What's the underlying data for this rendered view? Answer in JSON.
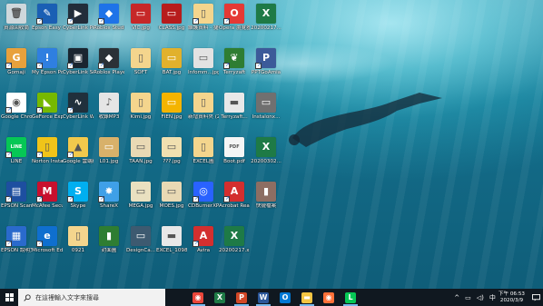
{
  "desktop": {
    "icons": [
      {
        "label": "資源回收筒",
        "color": "#cfd8dc",
        "glyph": "🗑",
        "shortcut": false,
        "col": 0,
        "row": 0
      },
      {
        "label": "Gomaji",
        "color": "#e8a13c",
        "glyph": "G",
        "shortcut": true,
        "col": 0,
        "row": 1
      },
      {
        "label": "Google Chrome",
        "color": "#ffffff",
        "glyph": "◉",
        "shortcut": true,
        "col": 0,
        "row": 2
      },
      {
        "label": "LINE",
        "color": "#06c755",
        "glyph": "LINE",
        "shortcut": true,
        "col": 0,
        "row": 3
      },
      {
        "label": "EPSON Scan",
        "color": "#1d4fa0",
        "glyph": "▤",
        "shortcut": true,
        "col": 0,
        "row": 4
      },
      {
        "label": "EPSON 說明文件",
        "color": "#2a6acc",
        "glyph": "▦",
        "shortcut": true,
        "col": 0,
        "row": 5
      },
      {
        "label": "Epson Easy Photo Print",
        "color": "#1a5fb4",
        "glyph": "✎",
        "shortcut": true,
        "col": 1,
        "row": 0
      },
      {
        "label": "My Epson Portal",
        "color": "#2f7fe0",
        "glyph": "!",
        "shortcut": true,
        "col": 1,
        "row": 1
      },
      {
        "label": "GeForce Experience",
        "color": "#76b900",
        "glyph": "◣",
        "shortcut": true,
        "col": 1,
        "row": 2
      },
      {
        "label": "Norton Installation",
        "color": "#f0c419",
        "glyph": "▯",
        "shortcut": true,
        "col": 1,
        "row": 3
      },
      {
        "label": "McAfee Security...",
        "color": "#c8102e",
        "glyph": "M",
        "shortcut": true,
        "col": 1,
        "row": 4
      },
      {
        "label": "Microsoft Edge",
        "color": "#0f6fcf",
        "glyph": "e",
        "shortcut": true,
        "col": 1,
        "row": 5
      },
      {
        "label": "CyberLink PowerDirec...",
        "color": "#222d3a",
        "glyph": "▶",
        "shortcut": true,
        "col": 2,
        "row": 0
      },
      {
        "label": "CyberLink Screen Re...",
        "color": "#1a2530",
        "glyph": "▣",
        "shortcut": true,
        "col": 2,
        "row": 1
      },
      {
        "label": "CyberLink WaveEdit...",
        "color": "#20303c",
        "glyph": "∿",
        "shortcut": true,
        "col": 2,
        "row": 2
      },
      {
        "label": "Google 雲端硬碟",
        "color": "#f2c94c",
        "glyph": "▲",
        "shortcut": true,
        "col": 2,
        "row": 3
      },
      {
        "label": "Skype",
        "color": "#00aff0",
        "glyph": "S",
        "shortcut": true,
        "col": 2,
        "row": 4
      },
      {
        "label": "0921",
        "color": "#f4d58d",
        "glyph": "▯",
        "shortcut": false,
        "col": 2,
        "row": 5
      },
      {
        "label": "Roblox Studio",
        "color": "#1e73e8",
        "glyph": "◆",
        "shortcut": true,
        "col": 3,
        "row": 0
      },
      {
        "label": "Roblox Player",
        "color": "#2b3137",
        "glyph": "◆",
        "shortcut": true,
        "col": 3,
        "row": 1
      },
      {
        "label": "收錄MP3",
        "color": "#e5e5e5",
        "glyph": "♪",
        "shortcut": false,
        "col": 3,
        "row": 2
      },
      {
        "label": "L01.jpg",
        "color": "#d8b16a",
        "glyph": "▭",
        "shortcut": false,
        "col": 3,
        "row": 3
      },
      {
        "label": "ShareX",
        "color": "#3fa0e8",
        "glyph": "✸",
        "shortcut": true,
        "col": 3,
        "row": 4
      },
      {
        "label": "封面圖",
        "color": "#2e7d32",
        "glyph": "▮",
        "shortcut": false,
        "col": 3,
        "row": 5
      },
      {
        "label": "VIC.jpg",
        "color": "#c62828",
        "glyph": "▭",
        "shortcut": false,
        "col": 4,
        "row": 0
      },
      {
        "label": "SOFT",
        "color": "#f4d58d",
        "glyph": "▯",
        "shortcut": false,
        "col": 4,
        "row": 1
      },
      {
        "label": "Kimi.jpg",
        "color": "#f4d58d",
        "glyph": "▯",
        "shortcut": false,
        "col": 4,
        "row": 2
      },
      {
        "label": "TAAN.jpg",
        "color": "#e9d9b4",
        "glyph": "▭",
        "shortcut": false,
        "col": 4,
        "row": 3
      },
      {
        "label": "MEGA.jpg",
        "color": "#e9e0c0",
        "glyph": "▭",
        "shortcut": false,
        "col": 4,
        "row": 4
      },
      {
        "label": "DesignCa...",
        "color": "#3d5a70",
        "glyph": "▭",
        "shortcut": false,
        "col": 4,
        "row": 5
      },
      {
        "label": "CLASS.jpg",
        "color": "#b71c1c",
        "glyph": "▭",
        "shortcut": false,
        "col": 5,
        "row": 0
      },
      {
        "label": "BAT.jpg",
        "color": "#e1b12c",
        "glyph": "▭",
        "shortcut": false,
        "col": 5,
        "row": 1
      },
      {
        "label": "FIEN.jpg",
        "color": "#f4b400",
        "glyph": "▭",
        "shortcut": false,
        "col": 5,
        "row": 2
      },
      {
        "label": "???.jpg",
        "color": "#f0e0b0",
        "glyph": "▭",
        "shortcut": false,
        "col": 5,
        "row": 3
      },
      {
        "label": "MOES.jpg",
        "color": "#e9d9b4",
        "glyph": "▭",
        "shortcut": false,
        "col": 5,
        "row": 4
      },
      {
        "label": "EXCEL_1098...",
        "color": "#e8e8e8",
        "glyph": "▬",
        "shortcut": false,
        "col": 5,
        "row": 5
      },
      {
        "label": "維護資料 - 捷徑",
        "color": "#f4d58d",
        "glyph": "▯",
        "shortcut": true,
        "col": 6,
        "row": 0
      },
      {
        "label": "Infomm...jpg",
        "color": "#e2e2e2",
        "glyph": "▭",
        "shortcut": false,
        "col": 6,
        "row": 1
      },
      {
        "label": "新增資料夾 (2)",
        "color": "#f4d58d",
        "glyph": "▯",
        "shortcut": false,
        "col": 6,
        "row": 2
      },
      {
        "label": "EXCEL圖",
        "color": "#f4d58d",
        "glyph": "▯",
        "shortcut": false,
        "col": 6,
        "row": 3
      },
      {
        "label": "CDBurnerXP",
        "color": "#2962ff",
        "glyph": "◎",
        "shortcut": true,
        "col": 6,
        "row": 4
      },
      {
        "label": "Avira",
        "color": "#d32f2f",
        "glyph": "A",
        "shortcut": true,
        "col": 6,
        "row": 5
      },
      {
        "label": "Opera 瀏覽器",
        "color": "#e53935",
        "glyph": "O",
        "shortcut": true,
        "col": 7,
        "row": 0
      },
      {
        "label": "Terryzaft",
        "color": "#2e7d32",
        "glyph": "❦",
        "shortcut": true,
        "col": 7,
        "row": 1
      },
      {
        "label": "Terryzaft...",
        "color": "#e8e8e8",
        "glyph": "▬",
        "shortcut": false,
        "col": 7,
        "row": 2
      },
      {
        "label": "Boot.pdf",
        "color": "#f5f5f5",
        "glyph": "PDF",
        "shortcut": false,
        "col": 7,
        "row": 3
      },
      {
        "label": "Acrobat Reader DC",
        "color": "#d32f2f",
        "glyph": "A",
        "shortcut": true,
        "col": 7,
        "row": 4
      },
      {
        "label": "20200217.x...",
        "color": "#1e7a46",
        "glyph": "X",
        "shortcut": false,
        "col": 7,
        "row": 5
      },
      {
        "label": "20200217...",
        "color": "#1e7a46",
        "glyph": "X",
        "shortcut": false,
        "col": 8,
        "row": 0
      },
      {
        "label": "PPTGoAmia",
        "color": "#3c5a99",
        "glyph": "P",
        "shortcut": true,
        "col": 8,
        "row": 1
      },
      {
        "label": "Instalonx...",
        "color": "#707070",
        "glyph": "▭",
        "shortcut": false,
        "col": 8,
        "row": 2
      },
      {
        "label": "20200302...",
        "color": "#1e7a46",
        "glyph": "X",
        "shortcut": false,
        "col": 8,
        "row": 3
      },
      {
        "label": "快捷檔案",
        "color": "#8d6e63",
        "glyph": "▮",
        "shortcut": false,
        "col": 8,
        "row": 4
      }
    ]
  },
  "taskbar": {
    "search_placeholder": "在這裡輸入文字來搜尋",
    "apps": [
      {
        "name": "chrome",
        "glyph": "◉",
        "color": "#e9463a",
        "active": true
      },
      {
        "name": "excel",
        "glyph": "X",
        "color": "#1e7a46",
        "active": false
      },
      {
        "name": "powerpoint",
        "glyph": "P",
        "color": "#d24726",
        "active": true
      },
      {
        "name": "word",
        "glyph": "W",
        "color": "#2b579a",
        "active": true
      },
      {
        "name": "outlook",
        "glyph": "O",
        "color": "#0078d4",
        "active": false
      },
      {
        "name": "file-explorer",
        "glyph": "▬",
        "color": "#f4c542",
        "active": true
      },
      {
        "name": "firefox",
        "glyph": "◉",
        "color": "#ff7139",
        "active": false
      },
      {
        "name": "line",
        "glyph": "L",
        "color": "#06c755",
        "active": true
      }
    ],
    "tray": {
      "chevron": "^",
      "ime": "中",
      "time_period": "下午 06:53",
      "date": "2020/3/9"
    }
  }
}
